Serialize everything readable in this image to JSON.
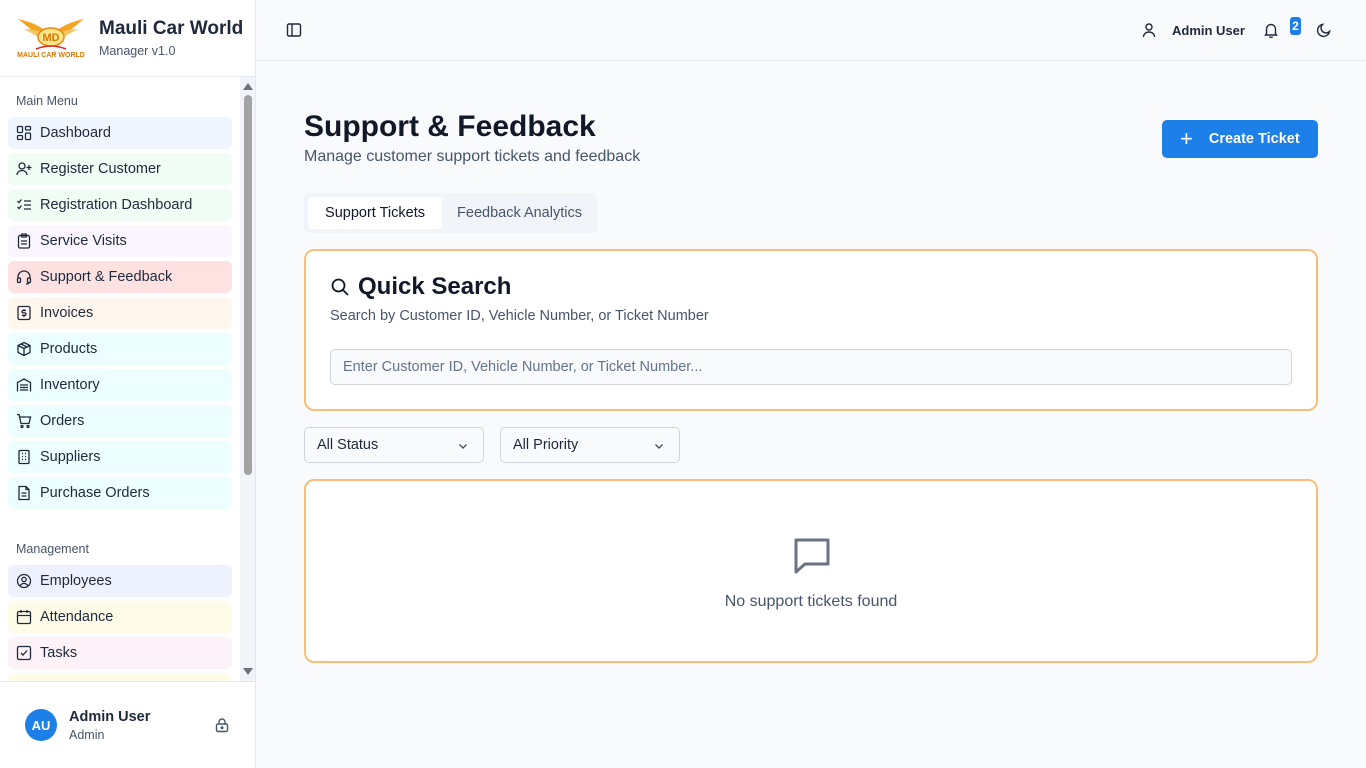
{
  "brand": {
    "title": "Mauli Car World",
    "subtitle": "Manager v1.0",
    "logo_text": "MAULI CAR WORLD"
  },
  "sidebar": {
    "main_menu_label": "Main Menu",
    "main_items": [
      {
        "label": "Dashboard",
        "icon": "dashboard-icon",
        "bg": "#eff6ff"
      },
      {
        "label": "Register Customer",
        "icon": "user-plus-icon",
        "bg": "#f0fdf4"
      },
      {
        "label": "Registration Dashboard",
        "icon": "list-checks-icon",
        "bg": "#f0fdf4"
      },
      {
        "label": "Service Visits",
        "icon": "clipboard-icon",
        "bg": "#faf5ff"
      },
      {
        "label": "Support & Feedback",
        "icon": "headset-icon",
        "bg": "#fee2e2"
      },
      {
        "label": "Invoices",
        "icon": "receipt-icon",
        "bg": "#fff7ed"
      },
      {
        "label": "Products",
        "icon": "package-icon",
        "bg": "#ecfeff"
      },
      {
        "label": "Inventory",
        "icon": "warehouse-icon",
        "bg": "#ecfeff"
      },
      {
        "label": "Orders",
        "icon": "cart-icon",
        "bg": "#ecfeff"
      },
      {
        "label": "Suppliers",
        "icon": "building-icon",
        "bg": "#ecfeff"
      },
      {
        "label": "Purchase Orders",
        "icon": "file-icon",
        "bg": "#ecfeff"
      }
    ],
    "management_label": "Management",
    "management_items": [
      {
        "label": "Employees",
        "icon": "user-circle-icon",
        "bg": "#eef2ff"
      },
      {
        "label": "Attendance",
        "icon": "calendar-icon",
        "bg": "#fefce8"
      },
      {
        "label": "Tasks",
        "icon": "check-square-icon",
        "bg": "#fdf2f8"
      }
    ],
    "active_item": "Support & Feedback"
  },
  "user": {
    "initials": "AU",
    "name": "Admin User",
    "role": "Admin"
  },
  "topbar": {
    "user_label": "Admin User",
    "notification_count": "2"
  },
  "page": {
    "title": "Support & Feedback",
    "subtitle": "Manage customer support tickets and feedback",
    "create_button": "Create Ticket"
  },
  "tabs": [
    {
      "label": "Support Tickets",
      "active": true
    },
    {
      "label": "Feedback Analytics",
      "active": false
    }
  ],
  "quick_search": {
    "title": "Quick Search",
    "subtitle": "Search by Customer ID, Vehicle Number, or Ticket Number",
    "placeholder": "Enter Customer ID, Vehicle Number, or Ticket Number...",
    "value": ""
  },
  "filters": {
    "status": "All Status",
    "priority": "All Priority"
  },
  "empty_state": {
    "message": "No support tickets found"
  },
  "colors": {
    "accent": "#1d7fe8",
    "card_border": "#f7bf7a",
    "active_menu_bg": "#fee2e2"
  }
}
